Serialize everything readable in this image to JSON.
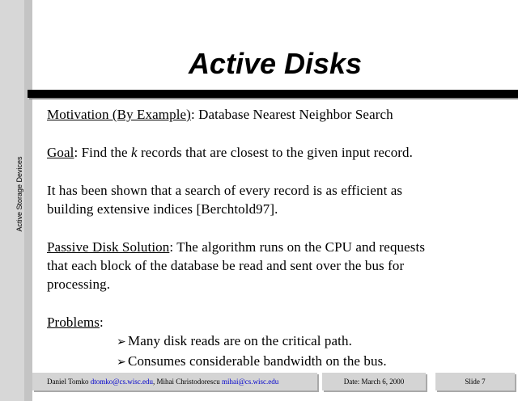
{
  "side_label": "Active Storage Devices",
  "title": "Active Disks",
  "motivation": {
    "label": "Motivation (By Example)",
    "text": ": Database Nearest Neighbor Search"
  },
  "goal": {
    "label": "Goal",
    "text_before": ": Find the ",
    "k": "k",
    "text_after": " records that are closest to the given input record."
  },
  "shown": {
    "line1": "It has been shown that a search of every record is as efficient as",
    "line2": "building extensive indices [Berchtold97]."
  },
  "passive": {
    "label": "Passive Disk Solution",
    "line1": ": The algorithm runs on the CPU and requests",
    "line2": "that each block of the database be read and sent over the bus for",
    "line3": "processing."
  },
  "problems": {
    "label": "Problems",
    "colon": ":",
    "arrow": "➢",
    "items": [
      "Many disk reads are on the critical path.",
      "Consumes considerable bandwidth on the bus."
    ]
  },
  "footer": {
    "author1": "Daniel Tomko ",
    "email1": "dtomko@cs.wisc.edu",
    "sep": ", Mihai Christodorescu ",
    "email2": "mihai@cs.wisc.edu",
    "date": "Date: March 6, 2000",
    "slide": "Slide 7"
  },
  "colors": {
    "left_bar": "#d7d7d7",
    "footer_bg": "#d4d4d4",
    "email": "#0000cc"
  }
}
